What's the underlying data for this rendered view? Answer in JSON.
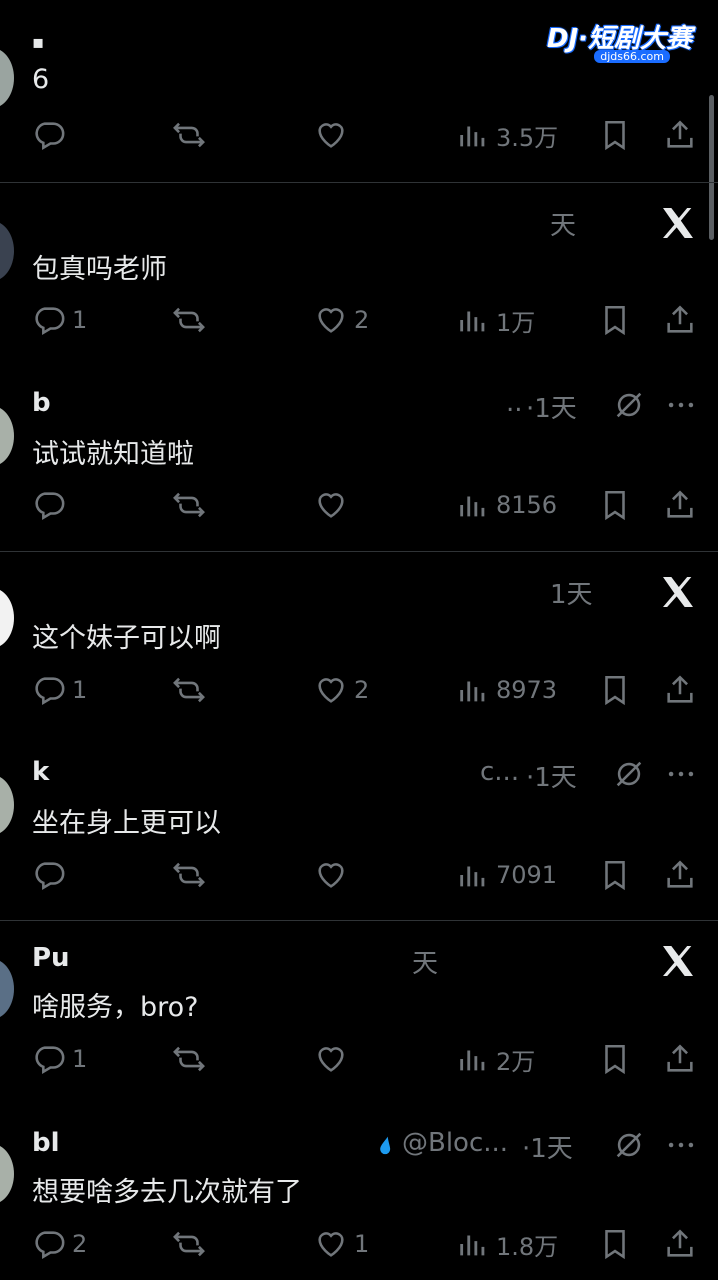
{
  "watermark": {
    "brand": "DJ·短剧大赛",
    "site": "djds66.com"
  },
  "posts": [
    {
      "name": "▪",
      "meta": "",
      "text": "6",
      "action_right": "none",
      "counts": {
        "reply": "",
        "repost": "",
        "like": "",
        "views": "3.5万"
      }
    },
    {
      "name": "",
      "meta": "天",
      "text": "包真吗老师",
      "action_right": "x-logo",
      "counts": {
        "reply": "1",
        "repost": "",
        "like": "2",
        "views": "1万"
      }
    },
    {
      "name": "b",
      "meta": "·1天",
      "meta_prefix": "..",
      "text": "试试就知道啦",
      "action_right": "mute-more",
      "counts": {
        "reply": "",
        "repost": "",
        "like": "",
        "views": "8156"
      }
    },
    {
      "name": "",
      "meta": "1天",
      "text": "这个妹子可以啊",
      "action_right": "x-logo",
      "counts": {
        "reply": "1",
        "repost": "",
        "like": "2",
        "views": "8973"
      }
    },
    {
      "name": "k",
      "meta": "·1天",
      "meta_prefix": "c...",
      "text": "坐在身上更可以",
      "action_right": "mute-more",
      "counts": {
        "reply": "",
        "repost": "",
        "like": "",
        "views": "7091"
      }
    },
    {
      "name": "Pu",
      "meta": "天",
      "text": "啥服务，bro?",
      "action_right": "x-logo",
      "counts": {
        "reply": "1",
        "repost": "",
        "like": "",
        "views": "2万"
      }
    },
    {
      "name": "bl",
      "meta": "·1天",
      "meta_prefix": "@Bloc...",
      "text": "想要啥多去几次就有了",
      "action_right": "mute-more",
      "counts": {
        "reply": "2",
        "repost": "",
        "like": "1",
        "views": "1.8万"
      }
    }
  ],
  "colors": {
    "background": "#000000",
    "text": "#e7e9ea",
    "muted": "#71767b",
    "separator": "#2f3336",
    "verified": "#1d9bf0"
  }
}
